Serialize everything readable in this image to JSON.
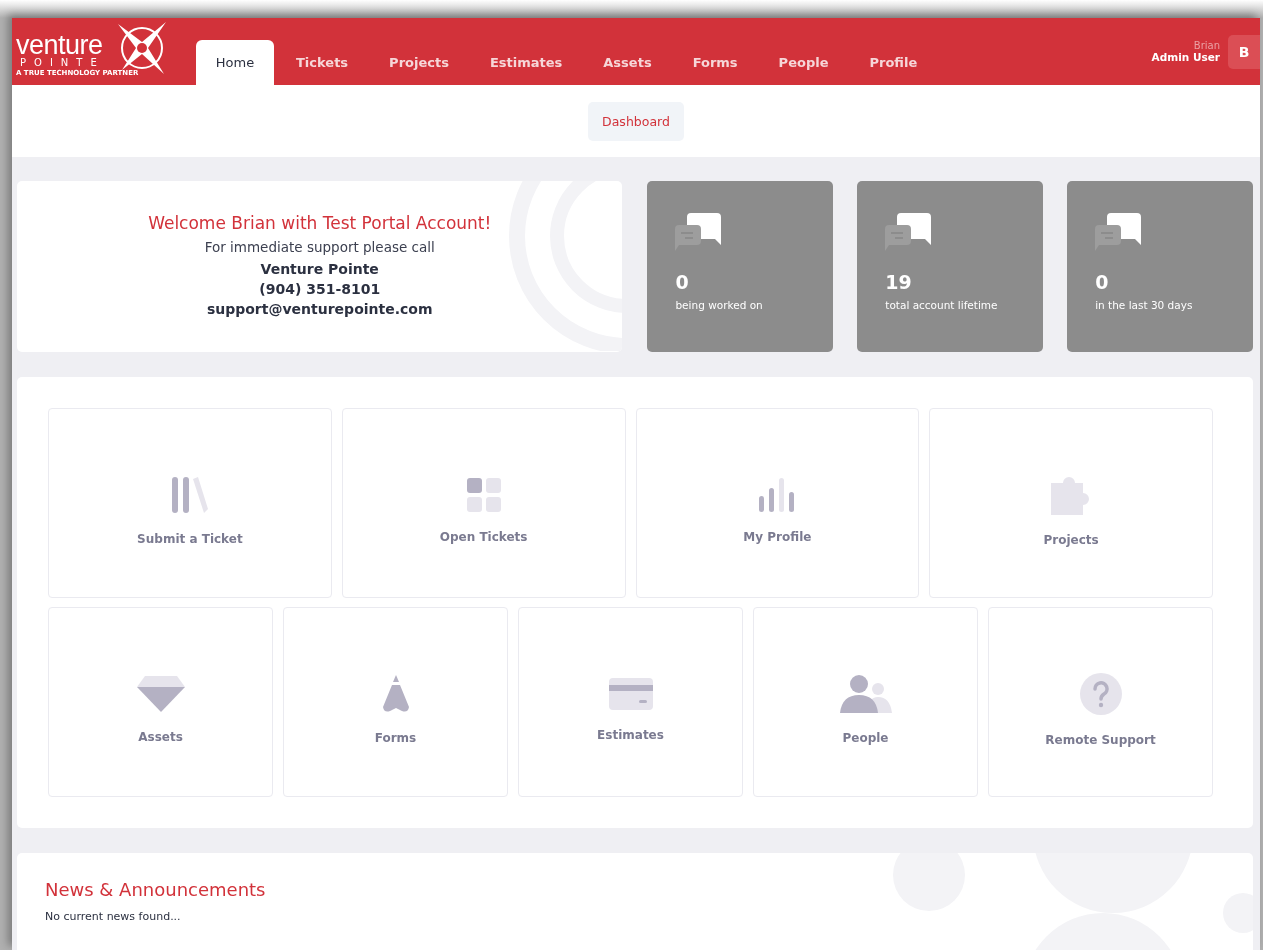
{
  "logo": {
    "word": "venture",
    "subword": "POINTE",
    "tagline": "A TRUE TECHNOLOGY PARTNER"
  },
  "tabs": [
    {
      "label": "Home",
      "selected": true
    },
    {
      "label": "Tickets",
      "selected": false
    },
    {
      "label": "Projects",
      "selected": false
    },
    {
      "label": "Estimates",
      "selected": false
    },
    {
      "label": "Assets",
      "selected": false
    },
    {
      "label": "Forms",
      "selected": false
    },
    {
      "label": "People",
      "selected": false
    },
    {
      "label": "Profile",
      "selected": false
    }
  ],
  "user": {
    "name": "Brian",
    "role": "Admin User",
    "initial": "B"
  },
  "subnav": [
    {
      "label": "Dashboard",
      "selected": true
    }
  ],
  "welcome": {
    "title": "Welcome Brian with Test Portal Account!",
    "subtitle": "For immediate support please call",
    "company": "Venture Pointe",
    "phone": "(904) 351-8101",
    "email": "support@venturepointe.com"
  },
  "stats": [
    {
      "value": "0",
      "label": "being worked on"
    },
    {
      "value": "19",
      "label": "total account lifetime"
    },
    {
      "value": "0",
      "label": "in the last 30 days"
    }
  ],
  "tiles_row_1": [
    {
      "kind": "books",
      "label": "Submit a Ticket"
    },
    {
      "kind": "grid",
      "label": "Open Tickets"
    },
    {
      "kind": "bars",
      "label": "My Profile"
    },
    {
      "kind": "puzzle",
      "label": "Projects"
    }
  ],
  "tiles_row_2": [
    {
      "kind": "diamond",
      "label": "Assets"
    },
    {
      "kind": "pen",
      "label": "Forms"
    },
    {
      "kind": "card",
      "label": "Estimates"
    },
    {
      "kind": "people",
      "label": "People"
    },
    {
      "kind": "help",
      "label": "Remote Support"
    }
  ],
  "news": {
    "title": "News & Announcements",
    "message": "No current news found..."
  }
}
